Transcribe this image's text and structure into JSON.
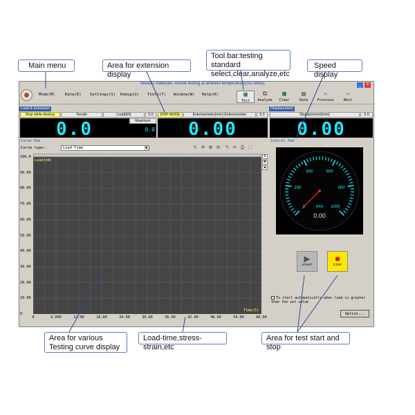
{
  "callouts": {
    "main_menu": "Main menu",
    "extension_display": "Area for extension display",
    "toolbar": "Tool bar:testing standard select,clear,analyze,etc",
    "speed_display": "Speed display",
    "curve_display": "Area for various Testing curve display",
    "load_time": "Load-time,stress-strain,etc",
    "start_stop": "Area for test start and stop"
  },
  "window": {
    "title": "Metallic materials-Tensile testing at ambient temperature(ISO 6892)"
  },
  "menu": [
    "Mode(M)",
    "Data(D)",
    "Settings(S)",
    "Debug(G)",
    "Tools(T)",
    "Window(W)",
    "Help(H)"
  ],
  "toolbar": {
    "test": "Test",
    "analyze": "Analyze",
    "clear": "Clear",
    "data": "Data",
    "previous": "Previous",
    "next": "Next"
  },
  "load_panel": {
    "label": "Load & Extension",
    "stop_label": "Stop while destroy",
    "mode": "Tensile",
    "unit": "Load(kN)",
    "reading": "0.0",
    "value": "0.0",
    "max_label": "Maximum",
    "max_value": "0.0"
  },
  "ext_panel": {
    "mode_label": "DISP MODE",
    "unit": "Extensometer(mm)-Extensometer",
    "reading": "0.0",
    "value": "0.00"
  },
  "disp_panel": {
    "label": "Displacement",
    "unit": "Displacement(mm)",
    "reading": "0.0",
    "value": "0.00"
  },
  "curve_pad": {
    "title": "Curve Pad",
    "curve_type_label": "Curve type:",
    "curve_type_value": "Load-Time",
    "y_label": "Load(kN)",
    "x_label": "Time(S)",
    "y_ticks": [
      "100.0",
      "90.00",
      "80.00",
      "70.00",
      "60.00",
      "50.00",
      "40.00",
      "30.00",
      "20.00",
      "10.00",
      "0"
    ],
    "x_ticks": [
      "0",
      "6.000",
      "12.00",
      "18.00",
      "24.00",
      "30.00",
      "36.00",
      "42.00",
      "48.00",
      "54.00",
      "60.00"
    ]
  },
  "control_pad": {
    "title": "Control Pad",
    "gauge_ticks": [
      "0",
      "200",
      "400",
      "600",
      "800",
      "1000"
    ],
    "gauge_unit": "kN/s",
    "gauge_value": "0.00",
    "gauge_reading": 0,
    "gauge_max": 1000,
    "start_label": "START",
    "stop_label": "STOP",
    "auto_start": "To start automatically when load is greater than the set value",
    "option_label": "Option..."
  },
  "colors": {
    "lcd_digits": "#1ee8ff",
    "plot_bg": "#454545",
    "callout_border": "#5a7fb0",
    "stop_btn": "#e01818",
    "stop_bg": "#ffe800"
  }
}
